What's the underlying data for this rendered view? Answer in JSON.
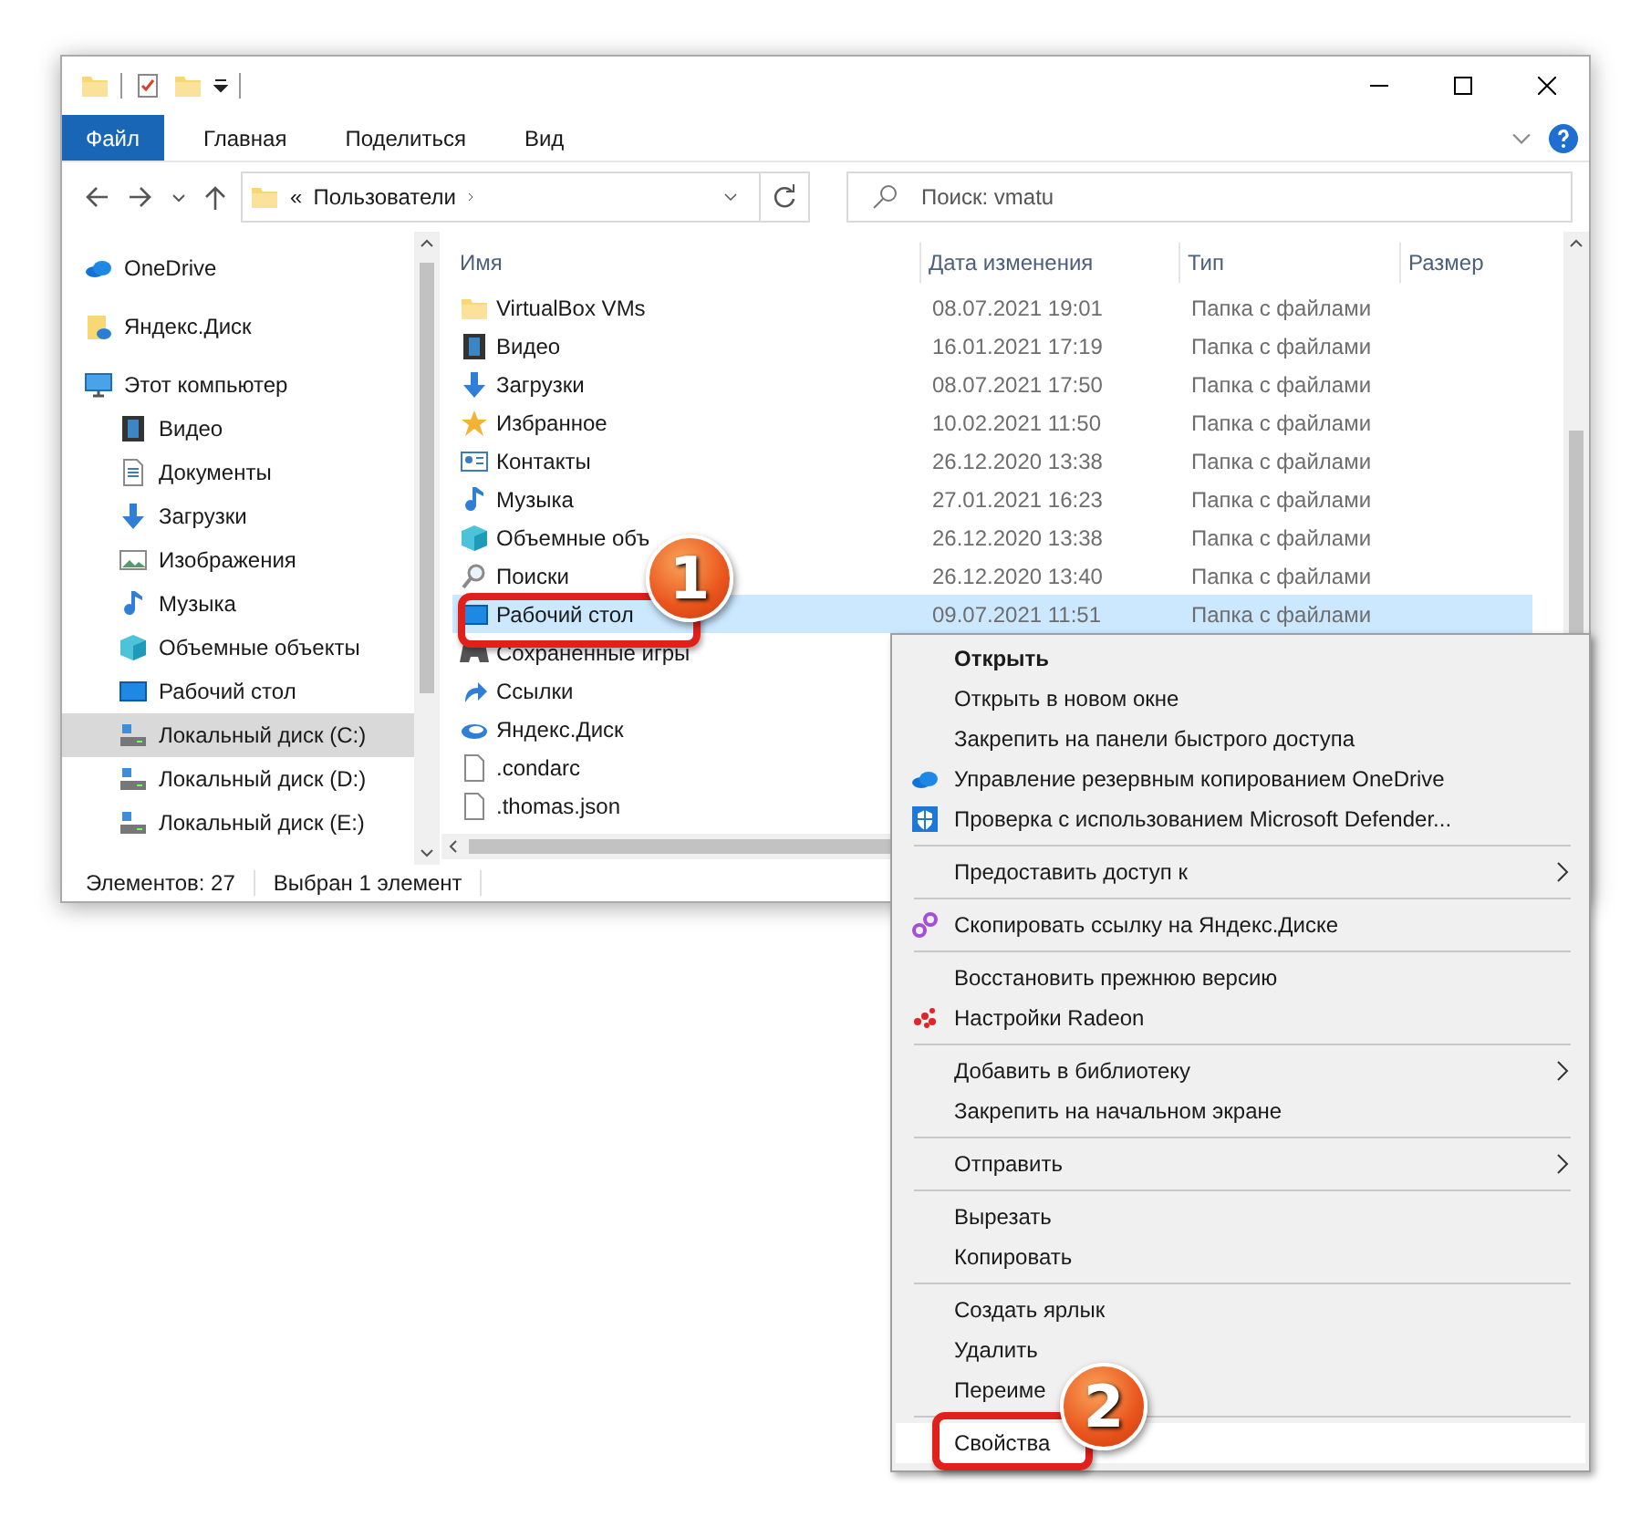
{
  "ribbon": {
    "tabs": [
      {
        "label": "Файл",
        "kind": "file"
      },
      {
        "label": "Главная",
        "kind": "tab"
      },
      {
        "label": "Поделиться",
        "kind": "tab"
      },
      {
        "label": "Вид",
        "kind": "tab"
      }
    ]
  },
  "address": {
    "overflow_glyph": "«",
    "segments": [
      "Пользователи"
    ]
  },
  "search": {
    "placeholder": "Поиск: vmatu"
  },
  "sidebar": {
    "items": [
      {
        "label": "OneDrive",
        "kind": "onedrive",
        "selected": false
      },
      {
        "label": "Яндекс.Диск",
        "kind": "yadisk-folder",
        "selected": false
      },
      {
        "label": "Этот компьютер",
        "kind": "computer",
        "selected": false,
        "children": [
          {
            "label": "Видео",
            "kind": "video",
            "selected": false
          },
          {
            "label": "Документы",
            "kind": "document",
            "selected": false
          },
          {
            "label": "Загрузки",
            "kind": "download",
            "selected": false
          },
          {
            "label": "Изображения",
            "kind": "images",
            "selected": false
          },
          {
            "label": "Музыка",
            "kind": "music",
            "selected": false
          },
          {
            "label": "Объемные объекты",
            "kind": "cube",
            "selected": false
          },
          {
            "label": "Рабочий стол",
            "kind": "desktop",
            "selected": false
          },
          {
            "label": "Локальный диск (C:)",
            "kind": "drive",
            "selected": true
          },
          {
            "label": "Локальный диск (D:)",
            "kind": "drive",
            "selected": false
          },
          {
            "label": "Локальный диск (E:)",
            "kind": "drive",
            "selected": false
          }
        ]
      }
    ]
  },
  "table": {
    "columns": [
      "Имя",
      "Дата изменения",
      "Тип",
      "Размер"
    ],
    "rows": [
      {
        "name": "VirtualBox VMs",
        "kind": "folder",
        "date": "08.07.2021 19:01",
        "type": "Папка с файлами",
        "selected": false
      },
      {
        "name": "Видео",
        "kind": "video",
        "date": "16.01.2021 17:19",
        "type": "Папка с файлами",
        "selected": false
      },
      {
        "name": "Загрузки",
        "kind": "download",
        "date": "08.07.2021 17:50",
        "type": "Папка с файлами",
        "selected": false
      },
      {
        "name": "Избранное",
        "kind": "star",
        "date": "10.02.2021 11:50",
        "type": "Папка с файлами",
        "selected": false
      },
      {
        "name": "Контакты",
        "kind": "contacts",
        "date": "26.12.2020 13:38",
        "type": "Папка с файлами",
        "selected": false
      },
      {
        "name": "Музыка",
        "kind": "music",
        "date": "27.01.2021 16:23",
        "type": "Папка с файлами",
        "selected": false
      },
      {
        "name": "Объемные объ",
        "kind": "cube",
        "date": "26.12.2020 13:38",
        "type": "Папка с файлами",
        "selected": false
      },
      {
        "name": "Поиски",
        "kind": "search",
        "date": "26.12.2020 13:40",
        "type": "Папка с файлами",
        "selected": false
      },
      {
        "name": "Рабочий стол",
        "kind": "desktop",
        "date": "09.07.2021 11:51",
        "type": "Папка с файлами",
        "selected": true
      },
      {
        "name": "Сохраненные игры",
        "kind": "games",
        "selected": false
      },
      {
        "name": "Ссылки",
        "kind": "link",
        "selected": false
      },
      {
        "name": "Яндекс.Диск",
        "kind": "yadisk",
        "selected": false
      },
      {
        "name": ".condarc",
        "kind": "file",
        "selected": false
      },
      {
        "name": ".thomas.json",
        "kind": "file",
        "selected": false
      }
    ]
  },
  "status_bar": [
    "Элементов: 27",
    "Выбран 1 элемент"
  ],
  "context_menu": {
    "items": [
      {
        "kind": "plain",
        "label": "Открыть",
        "bold": true,
        "submenu": false,
        "selected": false
      },
      {
        "kind": "plain",
        "label": "Открыть в новом окне",
        "bold": false,
        "submenu": false,
        "selected": false
      },
      {
        "kind": "plain",
        "label": "Закрепить на панели быстрого доступа",
        "bold": false,
        "submenu": false,
        "selected": false
      },
      {
        "kind": "onedrive",
        "label": "Управление резервным копированием OneDrive",
        "bold": false,
        "submenu": false,
        "selected": false
      },
      {
        "kind": "shield",
        "label": "Проверка с использованием Microsoft Defender...",
        "bold": false,
        "submenu": false,
        "selected": false
      },
      {
        "kind": "separator"
      },
      {
        "kind": "plain",
        "label": "Предоставить доступ к",
        "bold": false,
        "submenu": true,
        "selected": false
      },
      {
        "kind": "separator"
      },
      {
        "kind": "chain",
        "label": "Скопировать ссылку на Яндекс.Диске",
        "bold": false,
        "submenu": false,
        "selected": false
      },
      {
        "kind": "separator"
      },
      {
        "kind": "plain",
        "label": "Восстановить прежнюю версию",
        "bold": false,
        "submenu": false,
        "selected": false
      },
      {
        "kind": "radeon",
        "label": "Настройки Radeon",
        "bold": false,
        "submenu": false,
        "selected": false
      },
      {
        "kind": "separator"
      },
      {
        "kind": "plain",
        "label": "Добавить в библиотеку",
        "bold": false,
        "submenu": true,
        "selected": false
      },
      {
        "kind": "plain",
        "label": "Закрепить на начальном экране",
        "bold": false,
        "submenu": false,
        "selected": false
      },
      {
        "kind": "separator"
      },
      {
        "kind": "plain",
        "label": "Отправить",
        "bold": false,
        "submenu": true,
        "selected": false
      },
      {
        "kind": "separator"
      },
      {
        "kind": "plain",
        "label": "Вырезать",
        "bold": false,
        "submenu": false,
        "selected": false
      },
      {
        "kind": "plain",
        "label": "Копировать",
        "bold": false,
        "submenu": false,
        "selected": false
      },
      {
        "kind": "separator"
      },
      {
        "kind": "plain",
        "label": "Создать ярлык",
        "bold": false,
        "submenu": false,
        "selected": false
      },
      {
        "kind": "plain",
        "label": "Удалить",
        "bold": false,
        "submenu": false,
        "selected": false
      },
      {
        "kind": "plain",
        "label": "Переиме",
        "bold": false,
        "submenu": false,
        "selected": false
      },
      {
        "kind": "separator"
      },
      {
        "kind": "plain",
        "label": "Свойства",
        "bold": false,
        "submenu": false,
        "selected": true
      }
    ]
  },
  "callouts": [
    {
      "number": "1"
    },
    {
      "number": "2"
    }
  ]
}
